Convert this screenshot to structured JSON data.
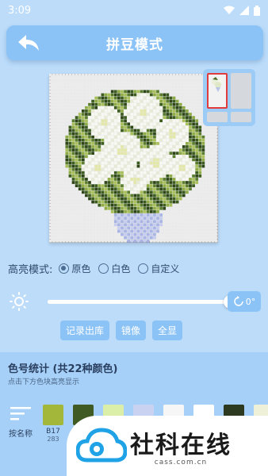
{
  "status_bar": {
    "time": "3:09"
  },
  "header": {
    "title": "拼豆模式"
  },
  "highlight_mode": {
    "label": "高亮模式:",
    "options": [
      {
        "label": "原色",
        "selected": true
      },
      {
        "label": "白色",
        "selected": false
      },
      {
        "label": "自定义",
        "selected": false
      }
    ]
  },
  "brightness": {
    "level": 1.0
  },
  "rotate": {
    "label": "0°"
  },
  "actions": {
    "record_label": "记录出库",
    "mirror_label": "镜像",
    "show_all_label": "全显"
  },
  "stats": {
    "title": "色号统计 (共22种颜色)",
    "subtitle": "点击下方色块高亮显示",
    "sort_label": "按名称",
    "swatches": [
      {
        "code": "B17",
        "count": "283",
        "color": "#a3b83b"
      },
      {
        "code": "",
        "count": "",
        "color": "#3f5a22"
      },
      {
        "code": "",
        "count": "",
        "color": "#dcefa8"
      },
      {
        "code": "",
        "count": "",
        "color": "#c9d2f0"
      },
      {
        "code": "",
        "count": "",
        "color": "#f6f6f6"
      },
      {
        "code": "",
        "count": "",
        "color": "#ffffff"
      },
      {
        "code": "",
        "count": "",
        "color": "#2e3a1f"
      },
      {
        "code": "",
        "count": "",
        "color": "#eef0d8"
      }
    ]
  },
  "watermark": {
    "title": "社科在线",
    "url": "cass.com.cn"
  },
  "colors": {
    "accent": "#8cc3f6",
    "background": "#bcdcfa"
  }
}
